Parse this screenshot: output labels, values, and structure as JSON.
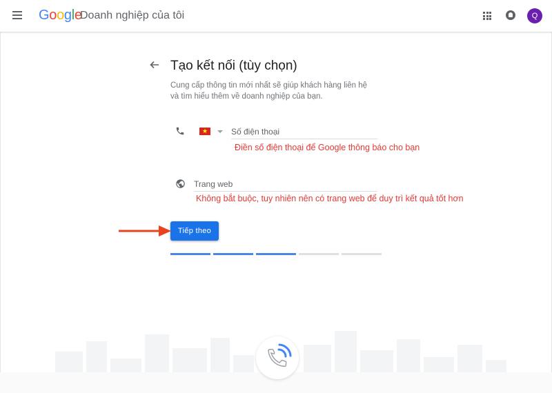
{
  "header": {
    "brand": {
      "G": "G",
      "o1": "o",
      "o2": "o",
      "g": "g",
      "l": "l",
      "e": "e"
    },
    "product_name": "Doanh nghiệp của tôi",
    "avatar_initial": "Q"
  },
  "step": {
    "title": "Tạo kết nối (tùy chọn)",
    "description": "Cung cấp thông tin mới nhất sẽ giúp khách hàng liên hệ và tìm hiểu thêm về doanh nghiệp của bạn."
  },
  "phone": {
    "country_flag": "vietnam-flag",
    "placeholder": "Số điện thoại",
    "value": ""
  },
  "website": {
    "placeholder": "Trang web",
    "value": ""
  },
  "annotations": {
    "phone_note": "Điền số điện thoại để Google thông báo cho bạn",
    "website_note": "Không bắt buộc, tuy nhiên nên có trang web để duy trì kết quả tốt hơn"
  },
  "actions": {
    "next_label": "Tiếp theo"
  },
  "progress": {
    "completed_steps": 3,
    "total_steps": 5
  },
  "colors": {
    "primary": "#1a73e8",
    "annotation": "#e53935",
    "avatar": "#6a1fb0",
    "progress_done": "#4a86e8",
    "progress_todo": "#e0e0e0"
  },
  "icons": [
    "menu-icon",
    "apps-icon",
    "notifications-icon",
    "back-arrow-icon",
    "phone-icon",
    "globe-icon",
    "phone-call-icon"
  ]
}
